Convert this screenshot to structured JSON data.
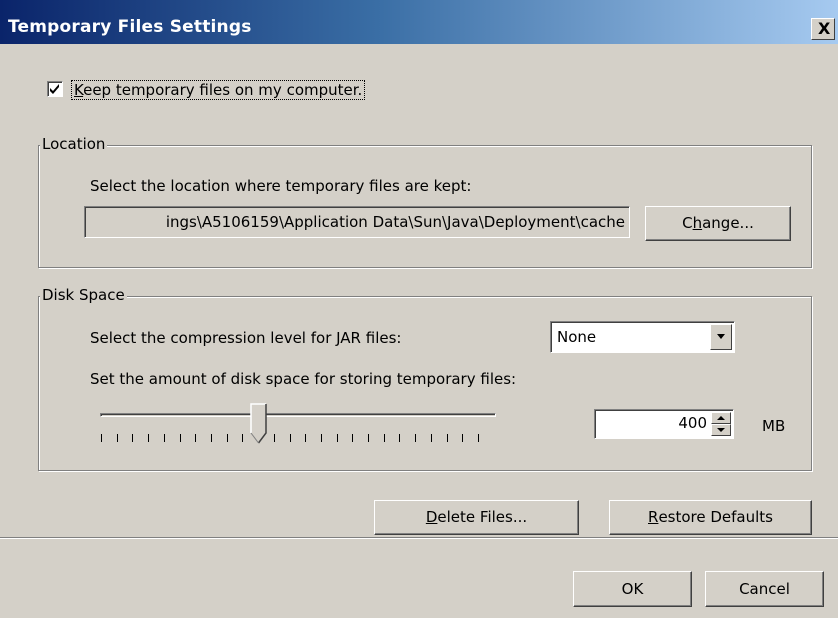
{
  "window": {
    "title": "Temporary Files Settings",
    "close_label": "X"
  },
  "keep_files": {
    "label_prefix": "",
    "label_underlined": "K",
    "label_rest": "eep temporary files on my computer.",
    "checked": true
  },
  "location": {
    "group_title": "Location",
    "description": "Select the location where temporary files are kept:",
    "path_value": "ings\\A5106159\\Application Data\\Sun\\Java\\Deployment\\cache",
    "change_button": {
      "pre": "C",
      "underlined": "h",
      "post": "ange..."
    }
  },
  "disk_space": {
    "group_title": "Disk Space",
    "compression_label": "Select the compression level for JAR files:",
    "compression_value": "None",
    "amount_label": "Set the amount of disk space for storing temporary files:",
    "amount_value": "400",
    "amount_unit": "MB",
    "slider_ticks": 25,
    "slider_position_tick": 10
  },
  "actions": {
    "delete_button": {
      "pre": "",
      "underlined": "D",
      "post": "elete Files..."
    },
    "restore_button": {
      "pre": "",
      "underlined": "R",
      "post": "estore Defaults"
    }
  },
  "footer": {
    "ok_label": "OK",
    "cancel_label": "Cancel"
  },
  "colors": {
    "face": "#d4d0c8",
    "title_start": "#0a246a",
    "title_end": "#a6caf0"
  }
}
